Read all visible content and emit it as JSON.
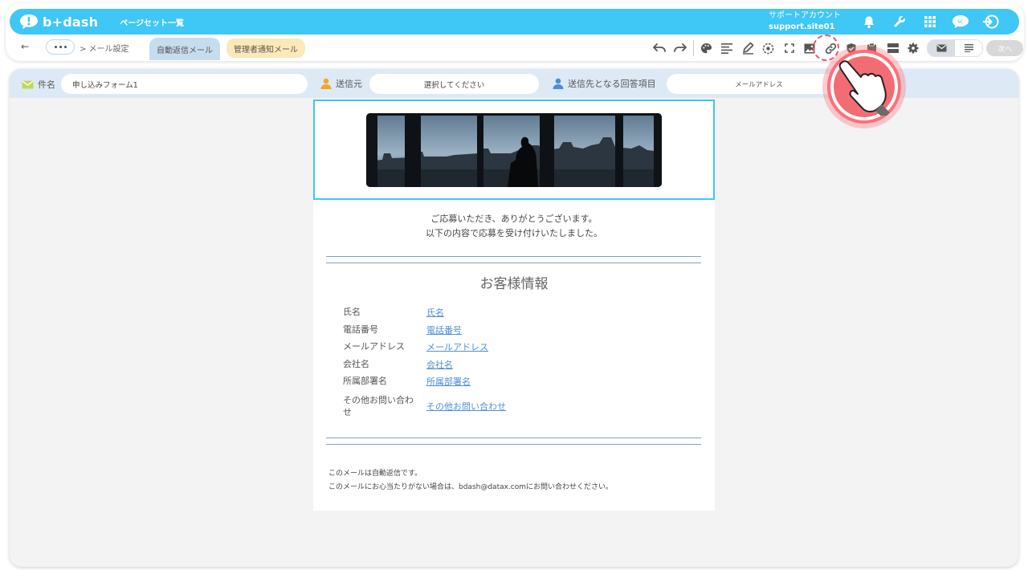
{
  "app": {
    "logo_text": "b+dash",
    "page_list": "ページセット一覧",
    "account_name": "サポートアカウント",
    "account_site": "support.site01"
  },
  "nav": {
    "back_icon": "back-arrow-icon",
    "crumb": "> メール設定",
    "tabs": [
      {
        "label": "自動返信メール",
        "active": true
      },
      {
        "label": "管理者通知メール",
        "active": false
      }
    ],
    "next_label": "次へ"
  },
  "meta": {
    "subject_label": "件名",
    "subject_value": "申し込みフォーム1",
    "sender_label": "送信元",
    "sender_value": "選択してください",
    "recipient_label": "送信先となる回答項目",
    "recipient_value": "メールアドレス"
  },
  "mail": {
    "intro_line1": "ご応募いただき、ありがとうございます。",
    "intro_line2": "以下の内容で応募を受け付けいたしました。",
    "section_title": "お客様情報",
    "fields": [
      {
        "label": "氏名",
        "value": "氏名"
      },
      {
        "label": "電話番号",
        "value": "電話番号"
      },
      {
        "label": "メールアドレス",
        "value": "メールアドレス"
      },
      {
        "label": "会社名",
        "value": "会社名"
      },
      {
        "label": "所属部署名",
        "value": "所属部署名"
      },
      {
        "label_line1": "その他お問い合わ",
        "label_line2": "せ",
        "value": "その他お問い合わせ"
      }
    ],
    "footer_line1": "このメールは自動返信です。",
    "footer_line2": "このメールにお心当たりがない場合は、bdash@datax.comにお問い合わせください。"
  },
  "colors": {
    "topbar": "#3fc7f5",
    "active_tab": "#c6dcef",
    "other_tab": "#fde9b8",
    "link": "#4f8fd6",
    "highlight": "#f26c74"
  }
}
